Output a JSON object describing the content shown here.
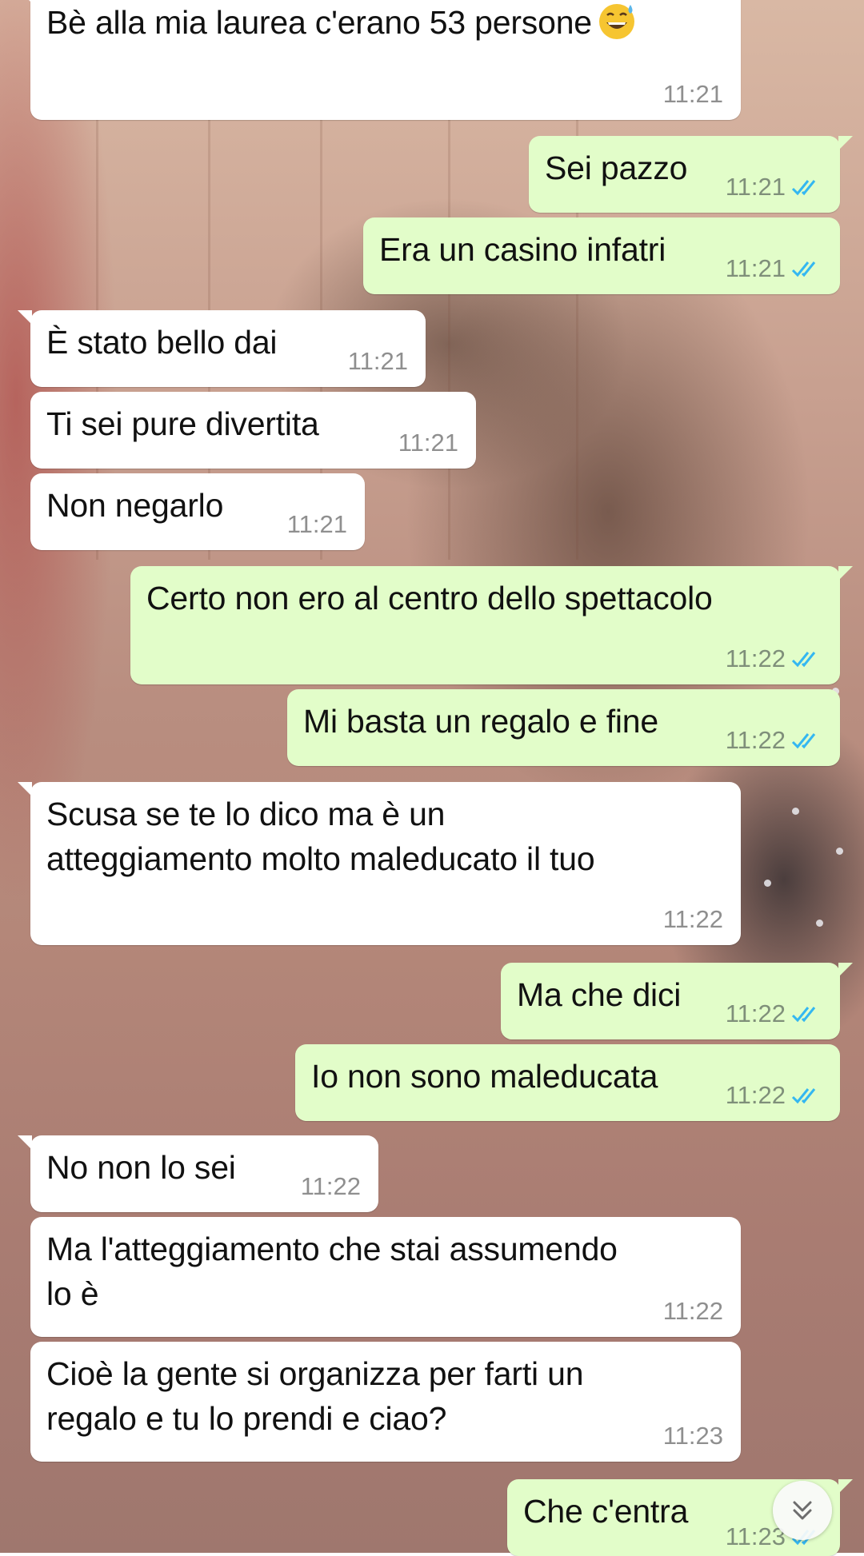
{
  "colors": {
    "incoming_bubble": "#ffffff",
    "outgoing_bubble": "#e2fdc9",
    "read_ticks": "#34b7f1",
    "timestamp": "#8f8f8f"
  },
  "messages": [
    {
      "direction": "incoming",
      "text": "Bè alla mia laurea c'erano 53 persone",
      "emoji": "grinning-face-with-sweat-emoji",
      "time": "11:21"
    },
    {
      "direction": "outgoing",
      "text": "Sei pazzo",
      "time": "11:21",
      "status": "read"
    },
    {
      "direction": "outgoing",
      "text": "Era un casino infatri",
      "time": "11:21",
      "status": "read"
    },
    {
      "direction": "incoming",
      "text": "È stato bello dai",
      "time": "11:21"
    },
    {
      "direction": "incoming",
      "text": "Ti sei pure divertita",
      "time": "11:21"
    },
    {
      "direction": "incoming",
      "text": "Non negarlo",
      "time": "11:21"
    },
    {
      "direction": "outgoing",
      "text": "Certo non ero al centro dello spettacolo",
      "time": "11:22",
      "status": "read"
    },
    {
      "direction": "outgoing",
      "text": "Mi basta un regalo e fine",
      "time": "11:22",
      "status": "read"
    },
    {
      "direction": "incoming",
      "text": "Scusa se te lo dico ma è un\natteggiamento molto maleducato il tuo",
      "time": "11:22"
    },
    {
      "direction": "outgoing",
      "text": "Ma che dici",
      "time": "11:22",
      "status": "read"
    },
    {
      "direction": "outgoing",
      "text": "Io non sono maleducata",
      "time": "11:22",
      "status": "read"
    },
    {
      "direction": "incoming",
      "text": "No non lo sei",
      "time": "11:22"
    },
    {
      "direction": "incoming",
      "text": "Ma l'atteggiamento che stai assumendo\nlo è",
      "time": "11:22"
    },
    {
      "direction": "incoming",
      "text": "Cioè la gente si organizza per farti un\nregalo e tu lo prendi e ciao?",
      "time": "11:23"
    },
    {
      "direction": "outgoing",
      "text": "Che c'entra",
      "time": "11:23",
      "status": "read"
    }
  ],
  "scroll_to_bottom": {
    "icon": "double-chevron-down-icon"
  }
}
